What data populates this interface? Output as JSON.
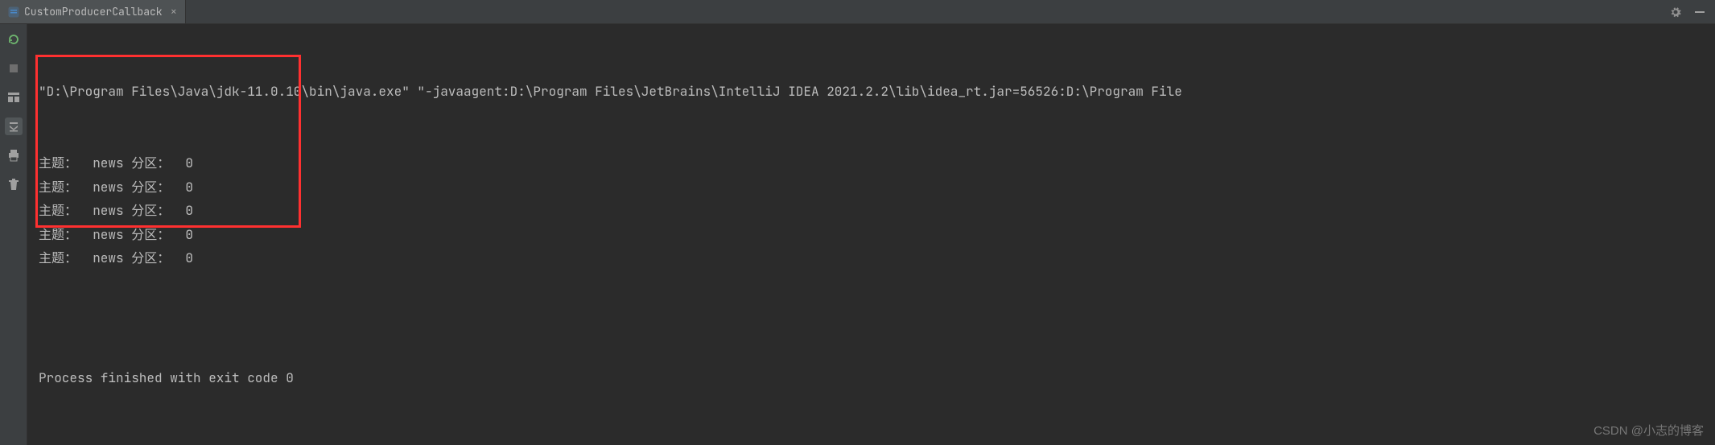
{
  "tab": {
    "title": "CustomProducerCallback",
    "close": "×"
  },
  "console": {
    "command": "\"D:\\Program Files\\Java\\jdk-11.0.10\\bin\\java.exe\" \"-javaagent:D:\\Program Files\\JetBrains\\IntelliJ IDEA 2021.2.2\\lib\\idea_rt.jar=56526:D:\\Program File",
    "lines": [
      {
        "topic_label": "主题：",
        "topic": "news",
        "partition_label": "分区：",
        "partition": "0"
      },
      {
        "topic_label": "主题：",
        "topic": "news",
        "partition_label": "分区：",
        "partition": "0"
      },
      {
        "topic_label": "主题：",
        "topic": "news",
        "partition_label": "分区：",
        "partition": "0"
      },
      {
        "topic_label": "主题：",
        "topic": "news",
        "partition_label": "分区：",
        "partition": "0"
      },
      {
        "topic_label": "主题：",
        "topic": "news",
        "partition_label": "分区：",
        "partition": "0"
      }
    ],
    "exit_message": "Process finished with exit code 0"
  },
  "watermark": "CSDN @小志的博客"
}
